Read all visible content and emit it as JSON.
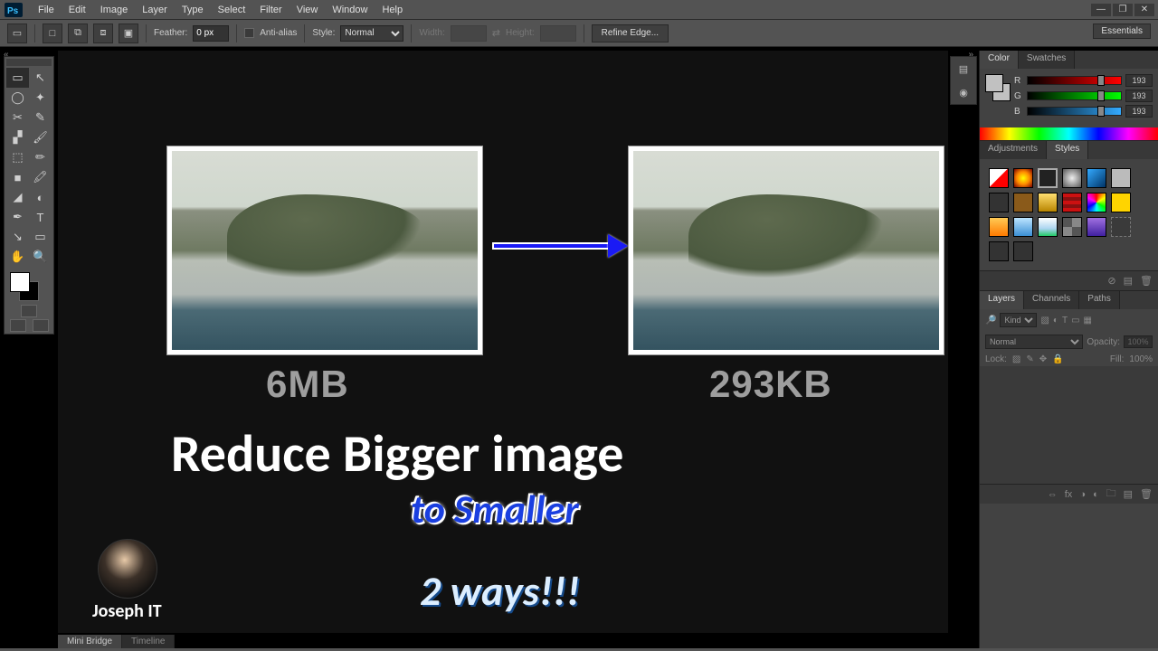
{
  "menu": [
    "File",
    "Edit",
    "Image",
    "Layer",
    "Type",
    "Select",
    "Filter",
    "View",
    "Window",
    "Help"
  ],
  "workspace": "Essentials",
  "optbar": {
    "feather_label": "Feather:",
    "feather_value": "0 px",
    "antialias": "Anti-alias",
    "style_label": "Style:",
    "style_value": "Normal",
    "width_label": "Width:",
    "height_label": "Height:",
    "refine": "Refine Edge..."
  },
  "color": {
    "tabs": [
      "Color",
      "Swatches"
    ],
    "channels": [
      {
        "l": "R",
        "v": "193"
      },
      {
        "l": "G",
        "v": "193"
      },
      {
        "l": "B",
        "v": "193"
      }
    ]
  },
  "styles_tabs": [
    "Adjustments",
    "Styles"
  ],
  "layers": {
    "tabs": [
      "Layers",
      "Channels",
      "Paths"
    ],
    "kind": "Kind",
    "blend": "Normal",
    "opacity_label": "Opacity:",
    "opacity_val": "100%",
    "lock_label": "Lock:",
    "fill_label": "Fill:",
    "fill_val": "100%"
  },
  "bottom_tabs": [
    "Mini Bridge",
    "Timeline"
  ],
  "canvas": {
    "size_left": "6MB",
    "size_right": "293KB",
    "headline": "Reduce Bigger image",
    "sub": "to Smaller",
    "ways": "2 ways!!!",
    "author": "Joseph IT"
  },
  "tool_icons": [
    "▭",
    "↖",
    "◯",
    "✦",
    "✂",
    "✎",
    "▞",
    "🖌",
    "⬚",
    "✏",
    "■",
    "🖍",
    "◢",
    "◐",
    "✒",
    "T",
    "↘",
    "▭",
    "✋",
    "🔍"
  ]
}
